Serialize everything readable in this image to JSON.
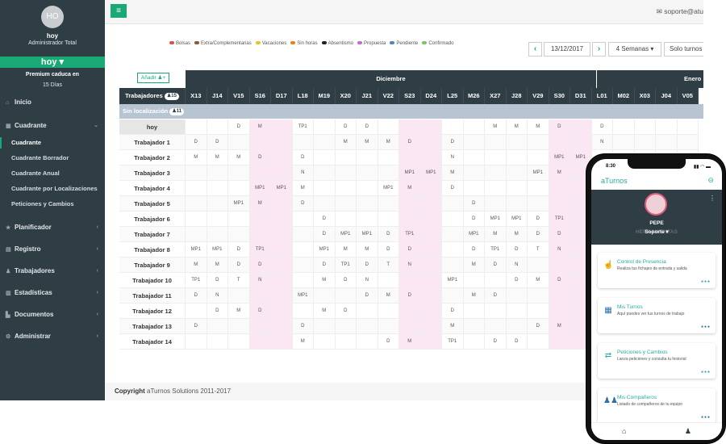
{
  "sidebar": {
    "avatar_initials": "HO",
    "user_name": "hoy",
    "user_role": "Administrador Total",
    "hoy_button": "hoy ▾",
    "premium": "Premium caduca en",
    "days": "15 Días",
    "items": [
      {
        "label": "Inicio",
        "icon": "home-icon",
        "glyph": "⌂",
        "chev": ""
      },
      {
        "label": "Cuadrante",
        "icon": "calendar-icon",
        "glyph": "▦",
        "chev": "⌄"
      },
      {
        "label": "Planificador",
        "icon": "star-icon",
        "glyph": "★",
        "chev": "‹"
      },
      {
        "label": "Registro",
        "icon": "book-icon",
        "glyph": "▤",
        "chev": "‹"
      },
      {
        "label": "Trabajadores",
        "icon": "users-icon",
        "glyph": "♟",
        "chev": "‹"
      },
      {
        "label": "Estadísticas",
        "icon": "chart-icon",
        "glyph": "▥",
        "chev": "‹"
      },
      {
        "label": "Documentos",
        "icon": "document-icon",
        "glyph": "▙",
        "chev": "‹"
      },
      {
        "label": "Administrar",
        "icon": "gear-icon",
        "glyph": "⚙",
        "chev": "‹"
      }
    ],
    "subitems": [
      "Cuadrante",
      "Cuadrante Borrador",
      "Cuadrante Anual",
      "Cuadrante por Localizaciones",
      "Peticiones y Cambios"
    ]
  },
  "topbar": {
    "menu_icon": "≡",
    "support": "✉  soporte@atu"
  },
  "legend": [
    {
      "label": "Bolsas",
      "color": "#d9534f"
    },
    {
      "label": "Extra/Complementarias",
      "color": "#8b5a3c"
    },
    {
      "label": "Vacaciones",
      "color": "#f0c419"
    },
    {
      "label": "Sin horas",
      "color": "#f07f19"
    },
    {
      "label": "Absentismo",
      "color": "#222222"
    },
    {
      "label": "Propuesta",
      "color": "#c86ad0"
    },
    {
      "label": "Pendiente",
      "color": "#5b7fbf"
    },
    {
      "label": "Confirmado",
      "color": "#7cc26b"
    }
  ],
  "controls": {
    "prev": "‹",
    "date": "13/12/2017",
    "next": "›",
    "weeks": "4 Semanas  ▾",
    "solo": "Solo turnos"
  },
  "grid": {
    "add_button": "Añadir ♟+",
    "month_dic": "Diciembre",
    "month_ene": "Enero",
    "col_header_label": "Trabajadores",
    "col_header_count": "♟15",
    "days": [
      "X13",
      "J14",
      "V15",
      "S16",
      "D17",
      "L18",
      "M19",
      "X20",
      "J21",
      "V22",
      "S23",
      "D24",
      "L25",
      "M26",
      "X27",
      "J28",
      "V29",
      "S30",
      "D31",
      "L01",
      "M02",
      "X03",
      "J04",
      "V05"
    ],
    "weekend_cols": [
      3,
      4,
      10,
      11,
      17,
      18
    ],
    "sin_localizacion": "Sin localización",
    "sin_count": "♟11",
    "rows": [
      {
        "name": "hoy",
        "cells": [
          "",
          "",
          "D",
          "M",
          "",
          "TP1",
          "",
          "D",
          "D",
          "",
          "",
          "",
          "",
          "",
          "M",
          "M",
          "M",
          "D",
          "",
          "D",
          "",
          "",
          "",
          ""
        ]
      },
      {
        "name": "Trabajador 1",
        "cells": [
          "D",
          "D",
          "",
          "",
          "",
          "",
          "",
          "M",
          "M",
          "M",
          "D",
          "",
          "D",
          "",
          "",
          "",
          "",
          "",
          "",
          "N",
          "",
          "",
          "",
          ""
        ]
      },
      {
        "name": "Trabajador 2",
        "cells": [
          "M",
          "M",
          "M",
          "D",
          "",
          "D",
          "",
          "",
          "",
          "",
          "",
          "",
          "N",
          "",
          "",
          "",
          "",
          "MP1",
          "MP1",
          "",
          "",
          "",
          "",
          ""
        ]
      },
      {
        "name": "Trabajador 3",
        "cells": [
          "",
          "",
          "",
          "",
          "",
          "N",
          "",
          "",
          "",
          "",
          "MP1",
          "MP1",
          "M",
          "",
          "",
          "",
          "MP1",
          "M",
          "",
          "",
          "",
          "",
          "",
          ""
        ]
      },
      {
        "name": "Trabajador 4",
        "cells": [
          "",
          "",
          "",
          "MP1",
          "MP1",
          "M",
          "",
          "",
          "",
          "MP1",
          "M",
          "",
          "D",
          "",
          "",
          "",
          "",
          "",
          "",
          "",
          "",
          "",
          "",
          ""
        ]
      },
      {
        "name": "Trabajador 5",
        "cells": [
          "",
          "",
          "MP1",
          "M",
          "",
          "D",
          "",
          "",
          "",
          "",
          "",
          "",
          "",
          "D",
          "",
          "",
          "",
          "",
          "",
          "",
          "",
          "",
          "",
          ""
        ]
      },
      {
        "name": "Trabajador 6",
        "cells": [
          "",
          "",
          "",
          "",
          "",
          "",
          "D",
          "",
          "",
          "",
          "",
          "",
          "",
          "D",
          "MP1",
          "MP1",
          "D",
          "TP1",
          "",
          "",
          "",
          "",
          "",
          ""
        ]
      },
      {
        "name": "Trabajador 7",
        "cells": [
          "",
          "",
          "",
          "",
          "",
          "",
          "D",
          "MP1",
          "MP1",
          "D",
          "TP1",
          "",
          "",
          "MP1",
          "M",
          "M",
          "D",
          "D",
          "",
          "",
          "",
          "",
          "",
          ""
        ]
      },
      {
        "name": "Trabajador 8",
        "cells": [
          "MP1",
          "MP1",
          "D",
          "TP1",
          "",
          "",
          "MP1",
          "M",
          "M",
          "D",
          "D",
          "",
          "",
          "D",
          "TP1",
          "D",
          "T",
          "N",
          "",
          "",
          "",
          "",
          "",
          ""
        ]
      },
      {
        "name": "Trabajador 9",
        "cells": [
          "M",
          "M",
          "D",
          "D",
          "",
          "",
          "D",
          "TP1",
          "D",
          "T",
          "N",
          "",
          "",
          "M",
          "D",
          "N",
          "",
          "",
          "",
          "",
          "",
          "",
          "",
          ""
        ]
      },
      {
        "name": "Trabajador 10",
        "cells": [
          "TP1",
          "D",
          "T",
          "N",
          "",
          "",
          "M",
          "D",
          "N",
          "",
          "",
          "",
          "MP1",
          "",
          "",
          "D",
          "M",
          "D",
          "",
          "",
          "",
          "",
          "",
          ""
        ]
      },
      {
        "name": "Trabajador 11",
        "cells": [
          "D",
          "N",
          "",
          "",
          "",
          "MP1",
          "",
          "",
          "D",
          "M",
          "D",
          "",
          "",
          "M",
          "D",
          "",
          "",
          "",
          "",
          "",
          "",
          "",
          "",
          ""
        ]
      },
      {
        "name": "Trabajador 12",
        "cells": [
          "",
          "D",
          "M",
          "D",
          "",
          "",
          "M",
          "D",
          "",
          "",
          "",
          "",
          "D",
          "",
          "",
          "",
          "",
          "",
          "",
          "",
          "",
          "",
          "",
          ""
        ]
      },
      {
        "name": "Trabajador 13",
        "cells": [
          "D",
          "",
          "",
          "",
          "",
          "D",
          "",
          "",
          "",
          "",
          "",
          "",
          "M",
          "",
          "",
          "",
          "D",
          "M",
          "",
          "",
          "",
          "",
          "",
          ""
        ]
      },
      {
        "name": "Trabajador 14",
        "cells": [
          "",
          "",
          "",
          "",
          "",
          "M",
          "",
          "",
          "",
          "D",
          "M",
          "",
          "TP1",
          "",
          "D",
          "D",
          "",
          "",
          "",
          "",
          "",
          "",
          "",
          ""
        ]
      }
    ]
  },
  "footer": {
    "bold": "Copyright",
    "rest": " aTurnos Solutions 2011-2017"
  },
  "phone": {
    "time": "8:30",
    "status": "▮▮ ◠ ▬",
    "logo": "aTurnos",
    "logout": "⊖",
    "name": "PEPE",
    "role": "Soporte ▾",
    "ghost": "HERRAMIENTAS",
    "menu_dots": "⋮",
    "cards": [
      {
        "title": "Control de Presencia",
        "desc": "Realiza tus fichajes de entrada y salida",
        "icon": "clock-touch-icon",
        "glyph": "☝",
        "color": "#2aa7a7"
      },
      {
        "title": "Mis Turnos",
        "desc": "Aquí puedes ver tus turnos de trabajo",
        "icon": "grid-icon",
        "glyph": "▦",
        "color": "#2f6fa7"
      },
      {
        "title": "Peticiones y Cambios",
        "desc": "Lanza peticiones y consulta tu historial",
        "icon": "swap-icon",
        "glyph": "⇄",
        "color": "#2aa7a7"
      },
      {
        "title": "Mis Compañeros",
        "desc": "Listado de compañeros de tu equipo",
        "icon": "group-icon",
        "glyph": "♟♟",
        "color": "#2f6fa7"
      }
    ],
    "card_dots": "●●●",
    "home": "⌂",
    "user": "♟"
  }
}
